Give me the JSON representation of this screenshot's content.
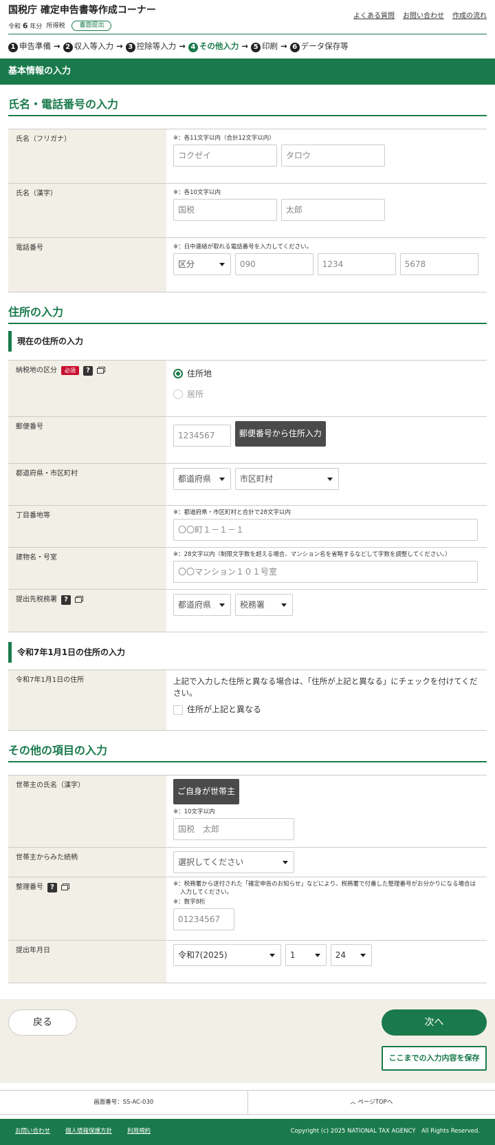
{
  "header": {
    "title": "国税庁 確定申告書等作成コーナー",
    "era": "令和",
    "year": "6",
    "year_unit": "年分",
    "tax_type": "所得税",
    "badge": "書面提出",
    "links": [
      "よくある質問",
      "お問い合わせ",
      "作成の流れ"
    ]
  },
  "steps": [
    {
      "num": "1",
      "label": "申告準備"
    },
    {
      "num": "2",
      "label": "収入等入力"
    },
    {
      "num": "3",
      "label": "控除等入力"
    },
    {
      "num": "4",
      "label": "その他入力"
    },
    {
      "num": "5",
      "label": "印刷"
    },
    {
      "num": "6",
      "label": "データ保存等"
    }
  ],
  "band": "基本情報の入力",
  "sec_name": {
    "title": "氏名・電話番号の入力",
    "kana_label": "氏名（フリガナ）",
    "kana_note": "※：各11文字以内（合計12文字以内）",
    "kana_last": "コクゼイ",
    "kana_first": "タロウ",
    "kanji_label": "氏名（漢字）",
    "kanji_note": "※：各10文字以内",
    "kanji_last": "国税",
    "kanji_first": "太郎",
    "tel_label": "電話番号",
    "tel_note": "※：日中連絡が取れる電話番号を入力してください。",
    "tel_type": "区分",
    "tel1": "090",
    "tel2": "1234",
    "tel3": "5678"
  },
  "sec_addr": {
    "title": "住所の入力",
    "sub1": "現在の住所の入力",
    "place_label": "納税地の区分",
    "required": "必須",
    "opt1": "住所地",
    "opt2": "居所",
    "zip_label": "郵便番号",
    "zip": "1234567",
    "zip_btn": "郵便番号から住所入力",
    "pref_label": "都道府県・市区町村",
    "pref": "都道府県",
    "city": "市区町村",
    "chome_label": "丁目番地等",
    "chome_note": "※：都道府県・市区町村と合計で28文字以内",
    "chome": "〇〇町１－１－１",
    "bldg_label": "建物名・号室",
    "bldg_note": "※：28文字以内（制限文字数を超える場合、マンション名を省略するなどして字数を調整してください。）",
    "bldg": "〇〇マンション１０１号室",
    "office_label": "提出先税務署",
    "office_pref": "都道府県",
    "office": "税務署",
    "sub2": "令和7年1月1日の住所の入力",
    "jan_label": "令和7年1月1日の住所",
    "jan_text": "上記で入力した住所と異なる場合は、「住所が上記と異なる」にチェックを付けてください。",
    "jan_chk": "住所が上記と異なる"
  },
  "sec_other": {
    "title": "その他の項目の入力",
    "head_label": "世帯主の氏名（漢字）",
    "head_btn": "ご自身が世帯主",
    "head_note": "※：10文字以内",
    "head_name": "国税　太郎",
    "rel_label": "世帯主からみた続柄",
    "rel": "選択してください",
    "ref_label": "整理番号",
    "ref_note1": "※：税務署から送付された「確定申告のお知らせ」などにより、税務署で付番した整理番号がお分かりになる場合は入力してください。",
    "ref_note2": "※：数字8桁",
    "ref": "01234567",
    "date_label": "提出年月日",
    "date_era": "令和7(2025)",
    "date_m": "1",
    "date_d": "24"
  },
  "actions": {
    "back": "戻る",
    "next": "次へ",
    "save": "ここまでの入力内容を保存"
  },
  "footer": {
    "screen_id": "画面番号：SS-AC-030",
    "page_top": "ページTOPへ",
    "links": [
      "お問い合わせ",
      "個人情報保護方針",
      "利用規約"
    ],
    "copyright": "Copyright (c) 2025 NATIONAL TAX AGENCY　All Rights Reserved."
  }
}
